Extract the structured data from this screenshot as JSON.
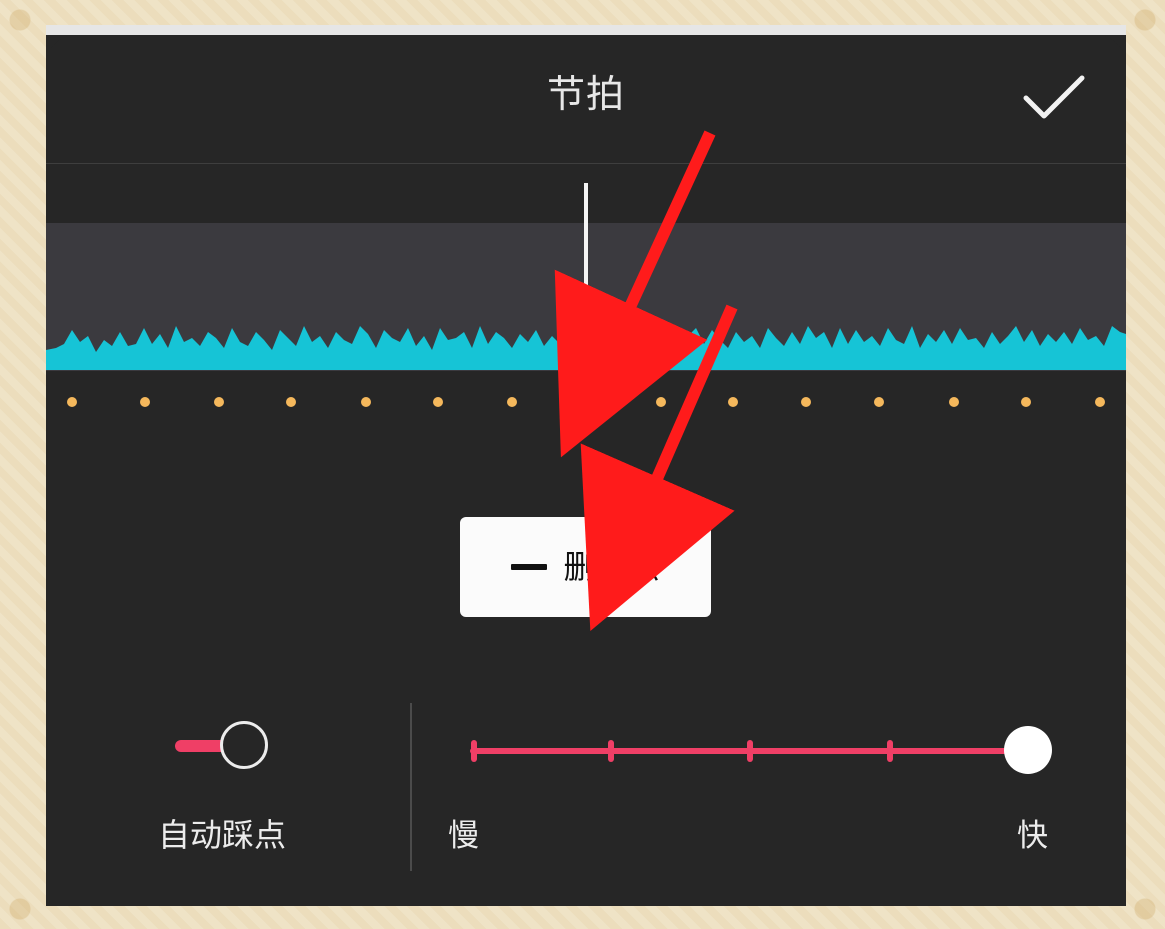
{
  "header": {
    "title": "节拍",
    "confirm_icon": "checkmark-icon"
  },
  "timeline": {
    "waveform_color": "#16c4d6",
    "beat_dot_color": "#f5b85c",
    "active_beat_index": 7
  },
  "actions": {
    "delete_label": "删除点"
  },
  "controls": {
    "auto_beat_label": "自动踩点",
    "auto_beat_enabled": true,
    "speed_slow_label": "慢",
    "speed_fast_label": "快",
    "speed_level": 1.0
  },
  "colors": {
    "accent": "#ef3f66",
    "background": "#262626",
    "arrow": "#ff1b1b"
  }
}
